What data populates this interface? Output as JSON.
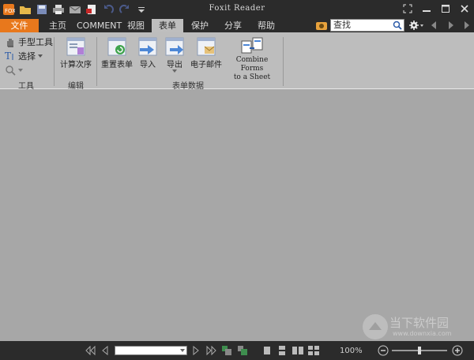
{
  "window": {
    "title": "Foxit Reader"
  },
  "tabs": [
    {
      "label": "文件"
    },
    {
      "label": "主页"
    },
    {
      "label": "COMMENT"
    },
    {
      "label": "视图"
    },
    {
      "label": "表单"
    },
    {
      "label": "保护"
    },
    {
      "label": "分享"
    },
    {
      "label": "帮助"
    }
  ],
  "search": {
    "value": "查找"
  },
  "ribbon": {
    "tools_group": {
      "hand_tool": "手型工具",
      "select": "选择",
      "label": "工具"
    },
    "edit_group": {
      "calc_order": "计算次序",
      "label": "编辑"
    },
    "form_data_group": {
      "reset": "重置表单",
      "import": "导入",
      "export": "导出",
      "email": "电子邮件",
      "combine_line1": "Combine Forms",
      "combine_line2": "to a Sheet",
      "label": "表单数据"
    }
  },
  "status": {
    "zoom": "100%"
  },
  "watermark": {
    "text": "当下软件园",
    "url": "www.downxia.com"
  }
}
